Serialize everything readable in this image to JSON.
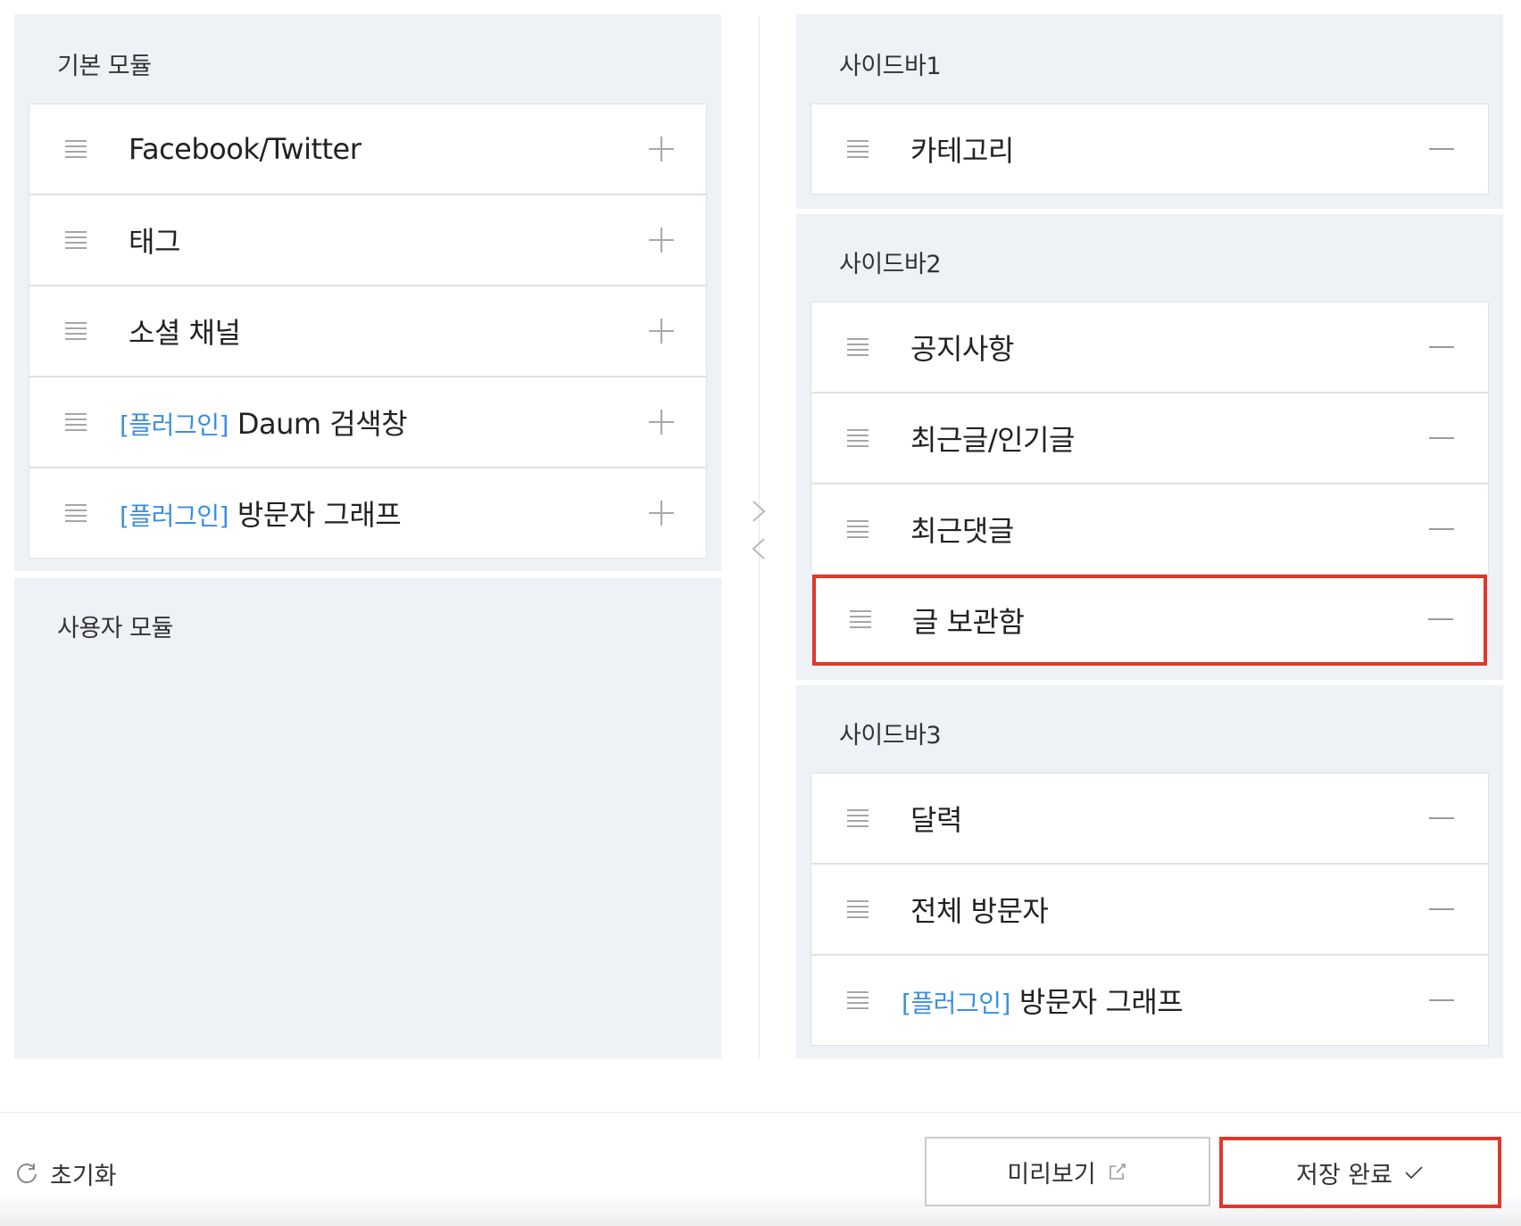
{
  "left": {
    "basic_title": "기본 모듈",
    "basic_items": [
      {
        "label": "Facebook/Twitter",
        "plugin": ""
      },
      {
        "label": "태그",
        "plugin": ""
      },
      {
        "label": "소셜 채널",
        "plugin": ""
      },
      {
        "label": "Daum 검색창",
        "plugin": "[플러그인]"
      },
      {
        "label": "방문자 그래프",
        "plugin": "[플러그인]"
      }
    ],
    "user_title": "사용자 모듈"
  },
  "right": {
    "sidebar1": {
      "title": "사이드바1",
      "items": [
        {
          "label": "카테고리",
          "plugin": ""
        }
      ]
    },
    "sidebar2": {
      "title": "사이드바2",
      "items": [
        {
          "label": "공지사항",
          "plugin": ""
        },
        {
          "label": "최근글/인기글",
          "plugin": ""
        },
        {
          "label": "최근댓글",
          "plugin": ""
        },
        {
          "label": "글 보관함",
          "plugin": ""
        }
      ]
    },
    "sidebar3": {
      "title": "사이드바3",
      "items": [
        {
          "label": "달력",
          "plugin": ""
        },
        {
          "label": "전체 방문자",
          "plugin": ""
        },
        {
          "label": "방문자 그래프",
          "plugin": "[플러그인]"
        }
      ]
    }
  },
  "footer": {
    "reset_label": "초기화",
    "preview_label": "미리보기",
    "save_label": "저장 완료"
  },
  "colors": {
    "panel_bg": "#eef1f5",
    "plugin_tag": "#3b8ee0",
    "highlight": "#e0382b"
  },
  "icons": {
    "drag": "drag-handle-icon",
    "add": "plus-icon",
    "remove": "minus-icon",
    "move_right": "chevron-right-icon",
    "move_left": "chevron-left-icon",
    "reset": "refresh-icon",
    "preview": "external-link-icon",
    "save": "checkmark-icon"
  }
}
